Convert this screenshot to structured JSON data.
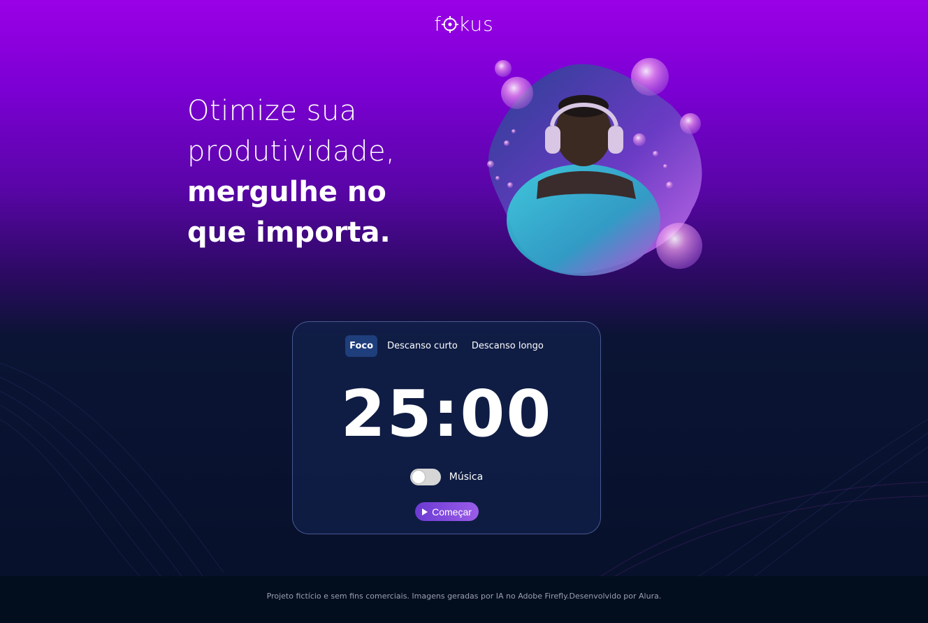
{
  "logo": {
    "text_left": "f",
    "text_right": "kus",
    "icon": "target-icon"
  },
  "hero": {
    "line1": "Otimize sua",
    "line2": "produtividade,",
    "line3": "mergulhe no",
    "line4": "que importa."
  },
  "timer_card": {
    "tabs": [
      {
        "label": "Foco",
        "active": true
      },
      {
        "label": "Descanso curto",
        "active": false
      },
      {
        "label": "Descanso longo",
        "active": false
      }
    ],
    "time": "25:00",
    "music_label": "Música",
    "music_enabled": false,
    "start_label": "Começar",
    "start_icon": "play-icon"
  },
  "footer": {
    "text": "Projeto fictício e sem fins comerciais. Imagens geradas por IA no Adobe Firefly.Desenvolvido por Alura."
  },
  "colors": {
    "top_purple": "#9a00e6",
    "dark_navy": "#061029",
    "tab_active": "#1f3e7c",
    "button_gradient_start": "#6c3ad2",
    "button_gradient_end": "#9a5ce8"
  }
}
